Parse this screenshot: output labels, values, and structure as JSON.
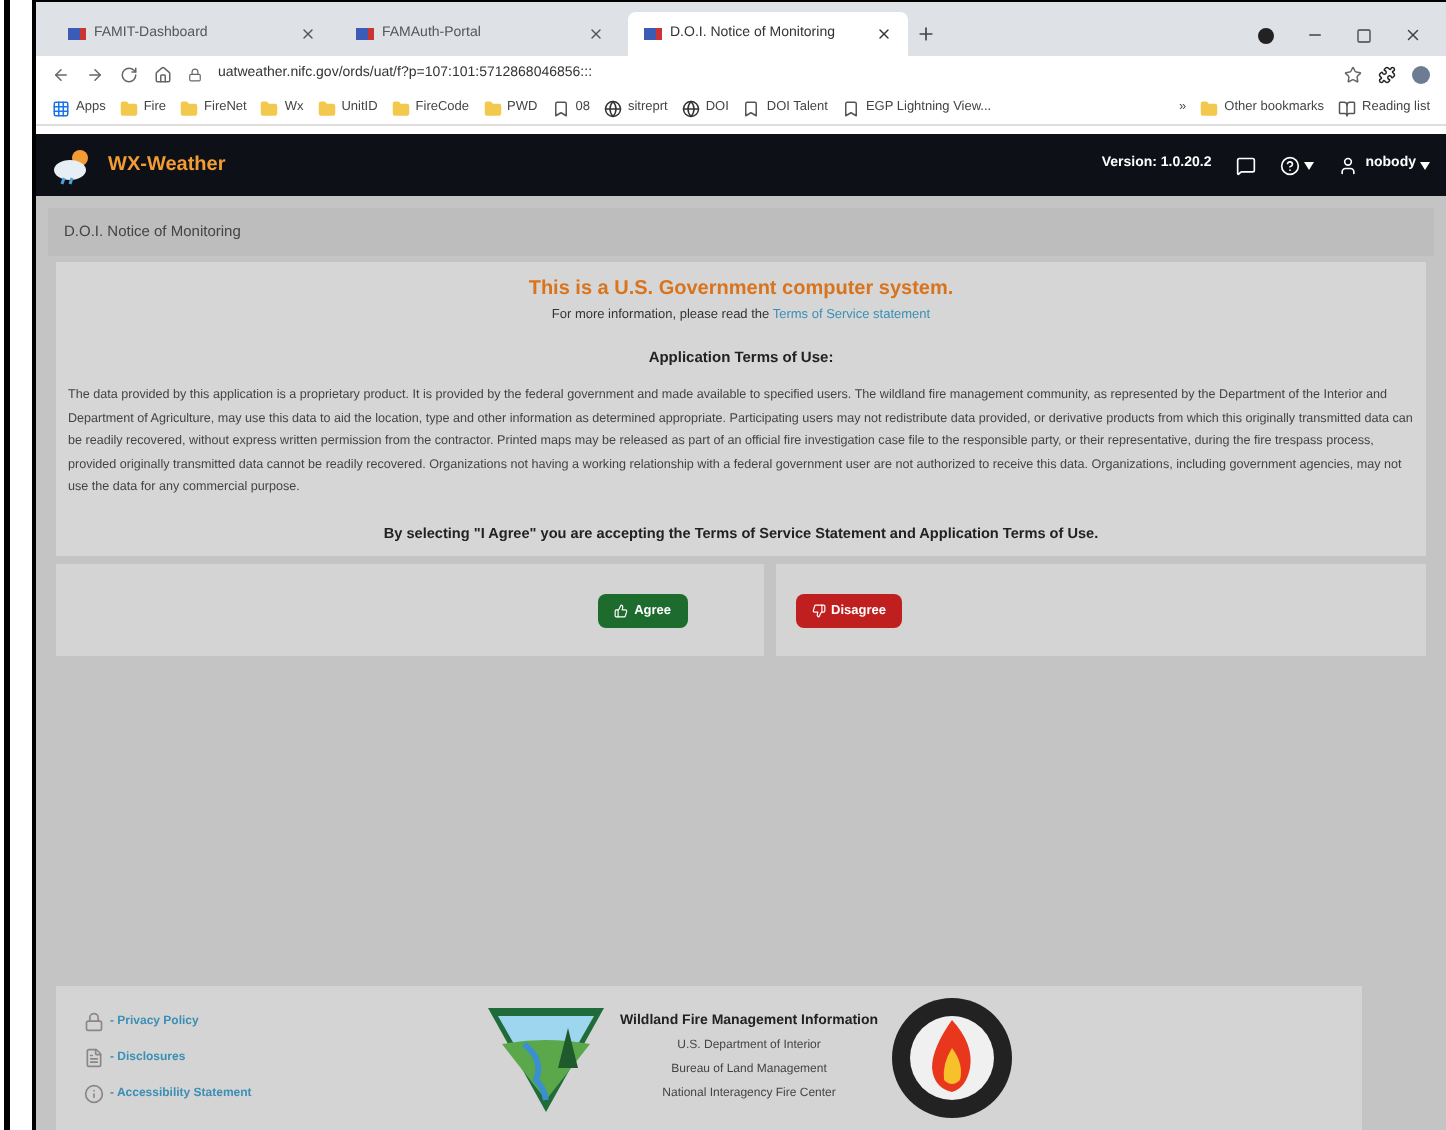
{
  "browser": {
    "tabs": [
      {
        "title": "FAMIT-Dashboard",
        "selected": false
      },
      {
        "title": "FAMAuth-Portal",
        "selected": false
      },
      {
        "title": "D.O.I. Notice of Monitoring",
        "selected": true
      }
    ],
    "url": "uatweather.nifc.gov/ords/uat/f?p=107:101:5712868046856:::",
    "bookmarks": [
      {
        "label": "Apps",
        "kind": "apps"
      },
      {
        "label": "Fire",
        "kind": "folder"
      },
      {
        "label": "FireNet",
        "kind": "folder"
      },
      {
        "label": "Wx",
        "kind": "folder"
      },
      {
        "label": "UnitID",
        "kind": "folder"
      },
      {
        "label": "FireCode",
        "kind": "folder"
      },
      {
        "label": "PWD",
        "kind": "folder"
      },
      {
        "label": "08",
        "kind": "site"
      },
      {
        "label": "sitreprt",
        "kind": "globe"
      },
      {
        "label": "DOI",
        "kind": "globe"
      },
      {
        "label": "DOI Talent",
        "kind": "site"
      },
      {
        "label": "EGP Lightning View...",
        "kind": "site"
      },
      {
        "label": "»",
        "kind": "more"
      },
      {
        "label": "Other bookmarks",
        "kind": "folder"
      },
      {
        "label": "Reading list",
        "kind": "reading"
      }
    ]
  },
  "header": {
    "app_name": "WX-Weather",
    "version": "Version: 1.0.20.2",
    "user": "nobody"
  },
  "notice_title": "D.O.I. Notice of Monitoring",
  "card": {
    "heading": "This is a U.S. Government computer system.",
    "info_prefix": "For more information, please read the",
    "info_link": "Terms of Service statement",
    "terms_title": "Application Terms of Use:",
    "terms_text": "The data provided by this application is a proprietary product. It is provided by the federal government and made available to specified users. The wildland fire management community, as represented by the Department of the Interior and Department of Agriculture, may use this data to aid the location, type and other information as determined appropriate. Participating users may not redistribute data provided, or derivative products from which this originally transmitted data can be readily recovered, without express written permission from the contractor. Printed maps may be released as part of an official fire investigation case file to the responsible party, or their representative, during the fire trespass process, provided originally transmitted data cannot be readily recovered. Organizations not having a working relationship with a federal government user are not authorized to receive this data. Organizations, including government agencies, may not use the data for any commercial purpose.",
    "consent": "By selecting \"I Agree\" you are accepting the Terms of Service Statement and Application Terms of Use."
  },
  "buttons": [
    {
      "label": "Agree",
      "kind": "agree"
    },
    {
      "label": "Disagree",
      "kind": "disagree"
    }
  ],
  "footer": {
    "links": [
      {
        "label": "- Privacy Policy",
        "kind": "lock"
      },
      {
        "label": "- Disclosures",
        "kind": "doc"
      },
      {
        "label": "- Accessibility Statement",
        "kind": "info"
      }
    ],
    "org_title": "Wildland Fire Management Information",
    "org_lines": [
      "U.S. Department of Interior",
      "Bureau of Land Management",
      "National Interagency Fire Center"
    ]
  }
}
